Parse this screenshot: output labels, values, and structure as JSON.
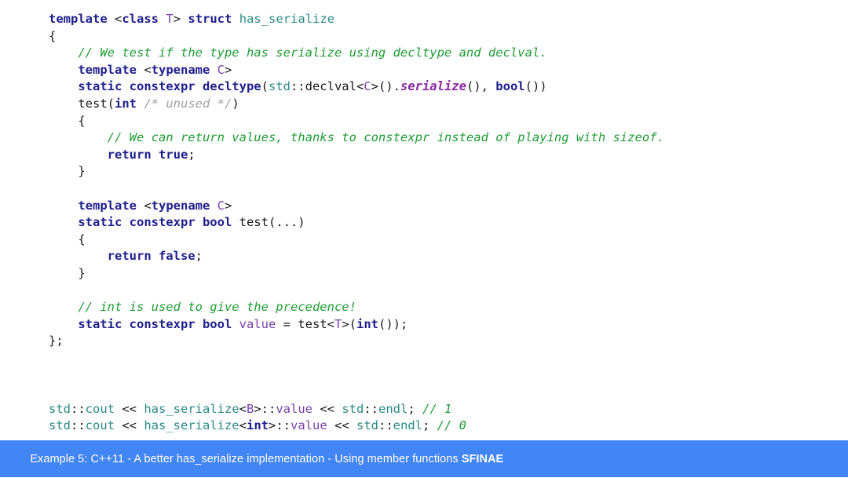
{
  "slide": {
    "background": "#ffffff",
    "banner_color": "#4285f4",
    "banner_text_color": "#ffffff"
  },
  "colors": {
    "keyword": "#20208c",
    "type": "#2a8a87",
    "template_param": "#7a3fa8",
    "member": "#8a2ba2",
    "comment": "#1f9c34",
    "comment_gray": "#a0a0a0",
    "plain": "#1a1a1a"
  },
  "code": {
    "language": "C++",
    "lines": [
      {
        "id": "l01",
        "tokens": [
          {
            "t": "template",
            "c": "kw"
          },
          {
            "t": " <",
            "c": "plain"
          },
          {
            "t": "class",
            "c": "kw"
          },
          {
            "t": " ",
            "c": "plain"
          },
          {
            "t": "T",
            "c": "tparam"
          },
          {
            "t": "> ",
            "c": "plain"
          },
          {
            "t": "struct",
            "c": "kw"
          },
          {
            "t": " ",
            "c": "plain"
          },
          {
            "t": "has_serialize",
            "c": "type"
          }
        ]
      },
      {
        "id": "l02",
        "tokens": [
          {
            "t": "{",
            "c": "plain"
          }
        ]
      },
      {
        "id": "l03",
        "tokens": [
          {
            "t": "    ",
            "c": "plain"
          },
          {
            "t": "// We test if the type has serialize using decltype and declval.",
            "c": "comment"
          }
        ]
      },
      {
        "id": "l04",
        "tokens": [
          {
            "t": "    ",
            "c": "plain"
          },
          {
            "t": "template",
            "c": "kw"
          },
          {
            "t": " <",
            "c": "plain"
          },
          {
            "t": "typename",
            "c": "kw"
          },
          {
            "t": " ",
            "c": "plain"
          },
          {
            "t": "C",
            "c": "tparam"
          },
          {
            "t": ">",
            "c": "plain"
          }
        ]
      },
      {
        "id": "l05",
        "tokens": [
          {
            "t": "    ",
            "c": "plain"
          },
          {
            "t": "static constexpr decltype",
            "c": "kw"
          },
          {
            "t": "(",
            "c": "plain"
          },
          {
            "t": "std",
            "c": "type"
          },
          {
            "t": "::declval<",
            "c": "plain"
          },
          {
            "t": "C",
            "c": "tparam"
          },
          {
            "t": ">().",
            "c": "plain"
          },
          {
            "t": "serialize",
            "c": "member"
          },
          {
            "t": "(), ",
            "c": "plain"
          },
          {
            "t": "bool",
            "c": "kw"
          },
          {
            "t": "())",
            "c": "plain"
          }
        ]
      },
      {
        "id": "l06",
        "tokens": [
          {
            "t": "    test(",
            "c": "plain"
          },
          {
            "t": "int",
            "c": "kw"
          },
          {
            "t": " ",
            "c": "plain"
          },
          {
            "t": "/* unused */",
            "c": "comment_gray"
          },
          {
            "t": ")",
            "c": "plain"
          }
        ]
      },
      {
        "id": "l07",
        "tokens": [
          {
            "t": "    {",
            "c": "plain"
          }
        ]
      },
      {
        "id": "l08",
        "tokens": [
          {
            "t": "        ",
            "c": "plain"
          },
          {
            "t": "// We can return values, thanks to constexpr instead of playing with sizeof.",
            "c": "comment"
          }
        ]
      },
      {
        "id": "l09",
        "tokens": [
          {
            "t": "        ",
            "c": "plain"
          },
          {
            "t": "return true",
            "c": "kw"
          },
          {
            "t": ";",
            "c": "plain"
          }
        ]
      },
      {
        "id": "l10",
        "tokens": [
          {
            "t": "    }",
            "c": "plain"
          }
        ]
      },
      {
        "id": "l11",
        "tokens": [
          {
            "t": " ",
            "c": "plain"
          }
        ]
      },
      {
        "id": "l12",
        "tokens": [
          {
            "t": "    ",
            "c": "plain"
          },
          {
            "t": "template",
            "c": "kw"
          },
          {
            "t": " <",
            "c": "plain"
          },
          {
            "t": "typename",
            "c": "kw"
          },
          {
            "t": " ",
            "c": "plain"
          },
          {
            "t": "C",
            "c": "tparam"
          },
          {
            "t": ">",
            "c": "plain"
          }
        ]
      },
      {
        "id": "l13",
        "tokens": [
          {
            "t": "    ",
            "c": "plain"
          },
          {
            "t": "static constexpr bool",
            "c": "kw"
          },
          {
            "t": " test(...)",
            "c": "plain"
          }
        ]
      },
      {
        "id": "l14",
        "tokens": [
          {
            "t": "    {",
            "c": "plain"
          }
        ]
      },
      {
        "id": "l15",
        "tokens": [
          {
            "t": "        ",
            "c": "plain"
          },
          {
            "t": "return false",
            "c": "kw"
          },
          {
            "t": ";",
            "c": "plain"
          }
        ]
      },
      {
        "id": "l16",
        "tokens": [
          {
            "t": "    }",
            "c": "plain"
          }
        ]
      },
      {
        "id": "l17",
        "tokens": [
          {
            "t": " ",
            "c": "plain"
          }
        ]
      },
      {
        "id": "l18",
        "tokens": [
          {
            "t": "    ",
            "c": "plain"
          },
          {
            "t": "// int is used to give the precedence!",
            "c": "comment"
          }
        ]
      },
      {
        "id": "l19",
        "tokens": [
          {
            "t": "    ",
            "c": "plain"
          },
          {
            "t": "static constexpr bool",
            "c": "kw"
          },
          {
            "t": " ",
            "c": "plain"
          },
          {
            "t": "value",
            "c": "tparam"
          },
          {
            "t": " = test<",
            "c": "plain"
          },
          {
            "t": "T",
            "c": "tparam"
          },
          {
            "t": ">(",
            "c": "plain"
          },
          {
            "t": "int",
            "c": "kw"
          },
          {
            "t": "());",
            "c": "plain"
          }
        ]
      },
      {
        "id": "l20",
        "tokens": [
          {
            "t": "};",
            "c": "plain"
          }
        ]
      },
      {
        "id": "l21",
        "tokens": [
          {
            "t": " ",
            "c": "plain"
          }
        ]
      },
      {
        "id": "l22",
        "tokens": [
          {
            "t": " ",
            "c": "plain"
          }
        ]
      },
      {
        "id": "l23",
        "tokens": [
          {
            "t": " ",
            "c": "plain"
          }
        ]
      },
      {
        "id": "l24",
        "tokens": [
          {
            "t": "std",
            "c": "type"
          },
          {
            "t": "::",
            "c": "plain"
          },
          {
            "t": "cout",
            "c": "type"
          },
          {
            "t": " << ",
            "c": "plain"
          },
          {
            "t": "has_serialize",
            "c": "type"
          },
          {
            "t": "<",
            "c": "plain"
          },
          {
            "t": "B",
            "c": "tparam"
          },
          {
            "t": ">::",
            "c": "plain"
          },
          {
            "t": "value",
            "c": "tparam"
          },
          {
            "t": " << ",
            "c": "plain"
          },
          {
            "t": "std",
            "c": "type"
          },
          {
            "t": "::",
            "c": "plain"
          },
          {
            "t": "endl",
            "c": "type"
          },
          {
            "t": "; ",
            "c": "plain"
          },
          {
            "t": "// 1",
            "c": "comment"
          }
        ]
      },
      {
        "id": "l25",
        "tokens": [
          {
            "t": "std",
            "c": "type"
          },
          {
            "t": "::",
            "c": "plain"
          },
          {
            "t": "cout",
            "c": "type"
          },
          {
            "t": " << ",
            "c": "plain"
          },
          {
            "t": "has_serialize",
            "c": "type"
          },
          {
            "t": "<",
            "c": "plain"
          },
          {
            "t": "int",
            "c": "kw"
          },
          {
            "t": ">::",
            "c": "plain"
          },
          {
            "t": "value",
            "c": "tparam"
          },
          {
            "t": " << ",
            "c": "plain"
          },
          {
            "t": "std",
            "c": "type"
          },
          {
            "t": "::",
            "c": "plain"
          },
          {
            "t": "endl",
            "c": "type"
          },
          {
            "t": "; ",
            "c": "plain"
          },
          {
            "t": "// 0",
            "c": "comment"
          }
        ]
      }
    ]
  },
  "banner": {
    "prefix": "Example 5: C++11 - A better has_serialize implementation - Using member functions ",
    "emphasis": "SFINAE"
  }
}
